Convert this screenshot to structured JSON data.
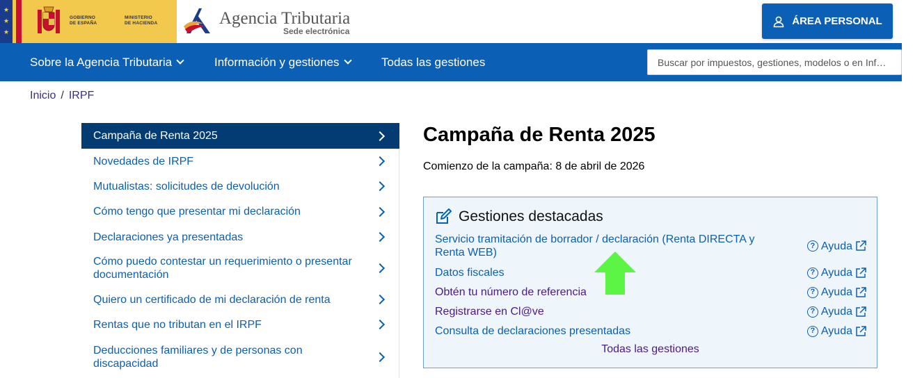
{
  "header": {
    "gov_text_1": "GOBIERNO DE ESPAÑA",
    "gov_text_1_lines": [
      "GOBIERNO",
      "DE ESPAÑA"
    ],
    "gov_text_2_lines": [
      "MINISTERIO",
      "DE HACIENDA"
    ],
    "brand_name": "Agencia Tributaria",
    "brand_sub": "Sede electrónica",
    "area_personal": "ÁREA PERSONAL"
  },
  "nav": {
    "items": [
      {
        "label": "Sobre la Agencia Tributaria",
        "dropdown": true
      },
      {
        "label": "Información y gestiones",
        "dropdown": true
      },
      {
        "label": "Todas las gestiones",
        "dropdown": false
      }
    ],
    "search_placeholder": "Buscar por impuestos, gestiones, modelos o en Infor…"
  },
  "breadcrumb": {
    "items": [
      "Inicio",
      "IRPF"
    ],
    "separator": "/"
  },
  "sidebar": {
    "items": [
      {
        "label": "Campaña de Renta 2025",
        "active": true
      },
      {
        "label": "Novedades de IRPF"
      },
      {
        "label": "Mutualistas: solicitudes de devolución"
      },
      {
        "label": "Cómo tengo que presentar mi declaración"
      },
      {
        "label": "Declaraciones ya presentadas"
      },
      {
        "label": "Cómo puedo contestar un requerimiento o presentar documentación"
      },
      {
        "label": "Quiero un certificado de mi declaración de renta"
      },
      {
        "label": "Rentas que no tributan en el IRPF"
      },
      {
        "label": "Deducciones familiares y de personas con discapacidad"
      }
    ]
  },
  "main": {
    "title": "Campaña de Renta 2025",
    "subtitle": "Comienzo de la campaña: 8 de abril de 2026",
    "panel": {
      "title": "Gestiones destacadas",
      "rows": [
        {
          "label": "Servicio tramitación de borrador / declaración (Renta DIRECTA y Renta WEB)",
          "help": "Ayuda"
        },
        {
          "label": "Datos fiscales",
          "help": "Ayuda"
        },
        {
          "label": "Obtén tu número de referencia",
          "help": "Ayuda"
        },
        {
          "label": "Registrarse en Cl@ve",
          "help": "Ayuda"
        },
        {
          "label": "Consulta de declaraciones presentadas",
          "help": "Ayuda"
        }
      ],
      "all_link": "Todas las gestiones"
    }
  },
  "colors": {
    "primary_blue": "#0b5fb5",
    "active_sidebar": "#033b73",
    "visited_link": "#4a1a8a",
    "panel_bg": "#eef5fb",
    "annotation_arrow": "#5cf545"
  }
}
